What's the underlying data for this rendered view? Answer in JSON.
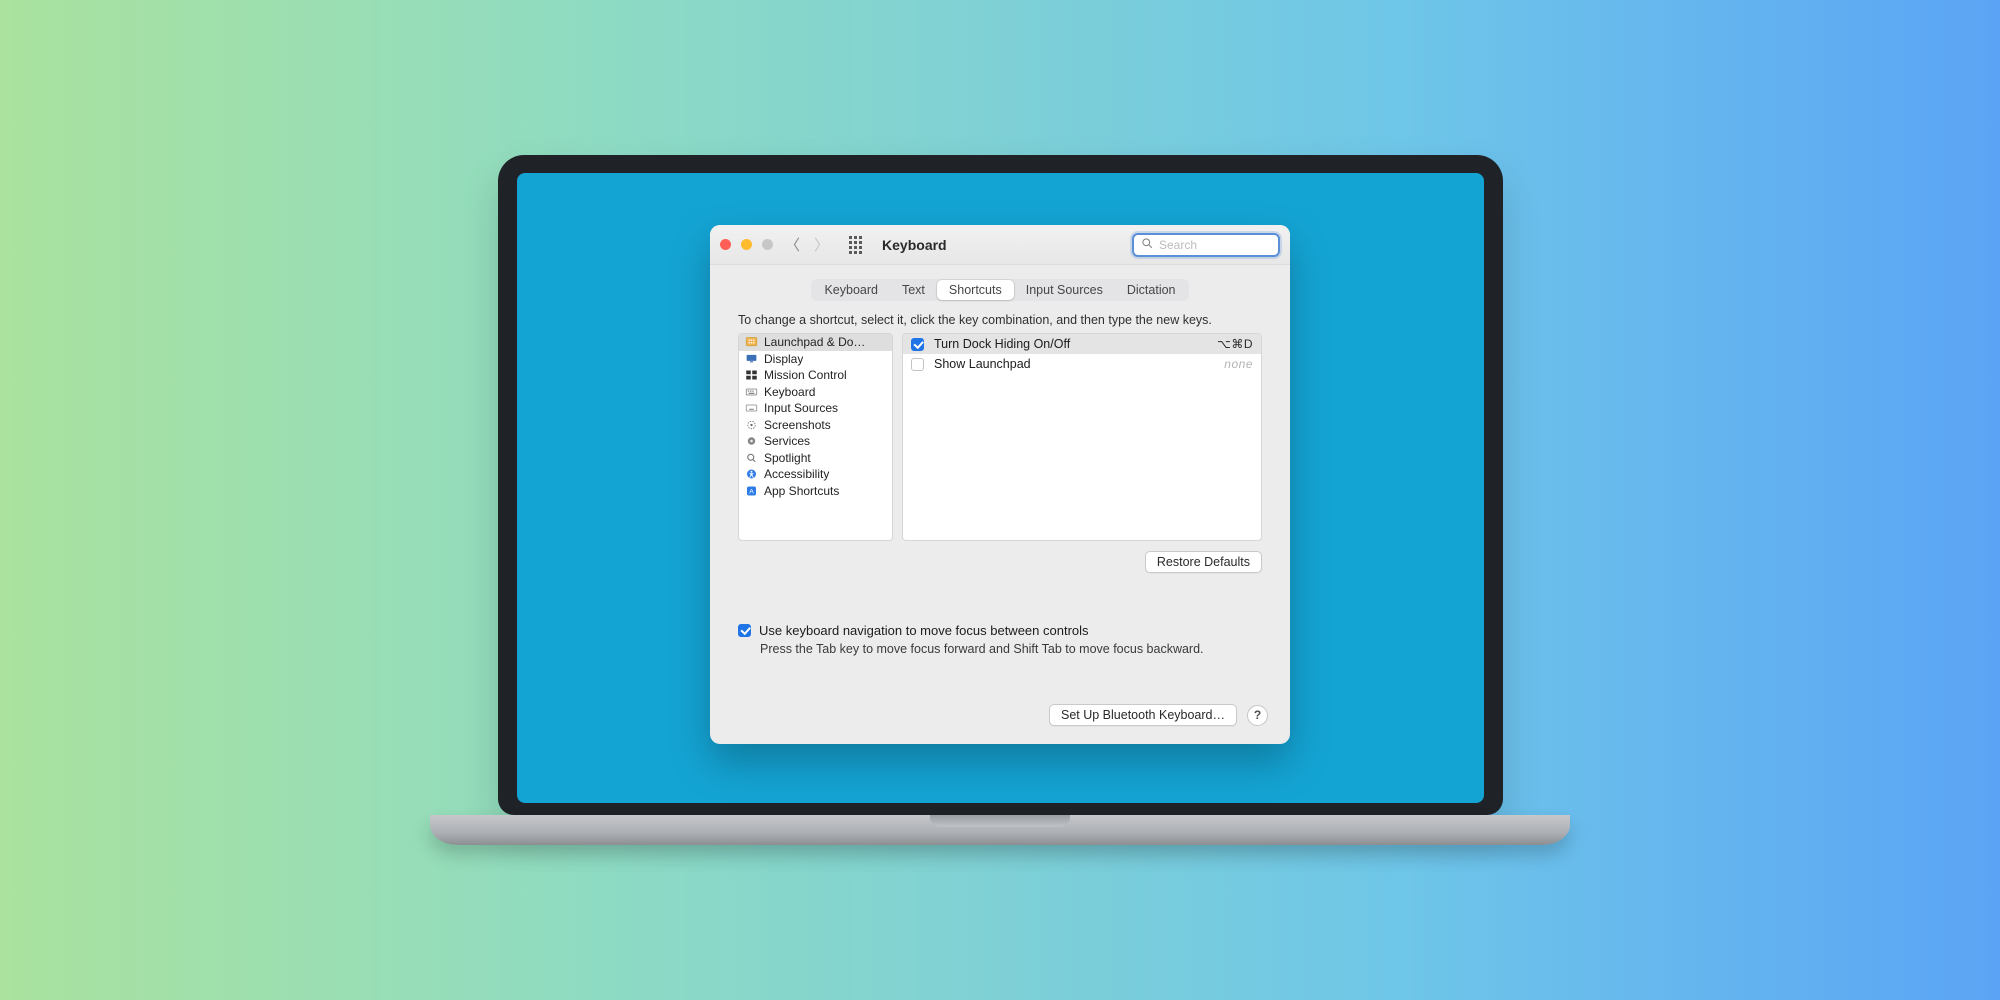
{
  "window": {
    "title": "Keyboard",
    "search_placeholder": "Search"
  },
  "tabs": [
    "Keyboard",
    "Text",
    "Shortcuts",
    "Input Sources",
    "Dictation"
  ],
  "active_tab": "Shortcuts",
  "instruction": "To change a shortcut, select it, click the key combination, and then type the new keys.",
  "categories": [
    "Launchpad & Do…",
    "Display",
    "Mission Control",
    "Keyboard",
    "Input Sources",
    "Screenshots",
    "Services",
    "Spotlight",
    "Accessibility",
    "App Shortcuts"
  ],
  "shortcuts": [
    {
      "enabled": true,
      "label": "Turn Dock Hiding On/Off",
      "key": "⌥⌘D"
    },
    {
      "enabled": false,
      "label": "Show Launchpad",
      "key": "none"
    }
  ],
  "buttons": {
    "restore": "Restore Defaults",
    "bluetooth": "Set Up Bluetooth Keyboard…",
    "help": "?"
  },
  "kbnav": {
    "label": "Use keyboard navigation to move focus between controls",
    "hint": "Press the Tab key to move focus forward and Shift Tab to move focus backward."
  }
}
